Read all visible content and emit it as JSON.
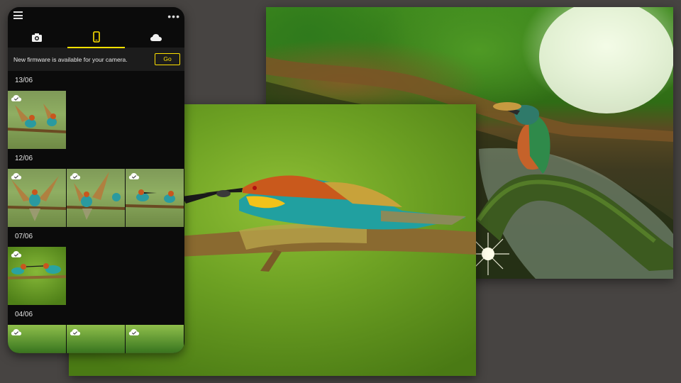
{
  "app": {
    "tabs": [
      {
        "name": "camera-icon",
        "active": false
      },
      {
        "name": "phone-icon",
        "active": true
      },
      {
        "name": "cloud-icon",
        "active": false
      }
    ],
    "colors": {
      "accent": "#ffe100",
      "background": "#0b0b0b",
      "banner": "#1c1c1c"
    }
  },
  "banner": {
    "message": "New firmware is available for your camera.",
    "go_label": "Go"
  },
  "gallery": {
    "groups": [
      {
        "date": "13/06",
        "count": 1
      },
      {
        "date": "12/06",
        "count": 3
      },
      {
        "date": "07/06",
        "count": 1
      },
      {
        "date": "04/06",
        "count": 3
      }
    ],
    "thumbnail_badge_icon": "cloud-check-icon"
  }
}
